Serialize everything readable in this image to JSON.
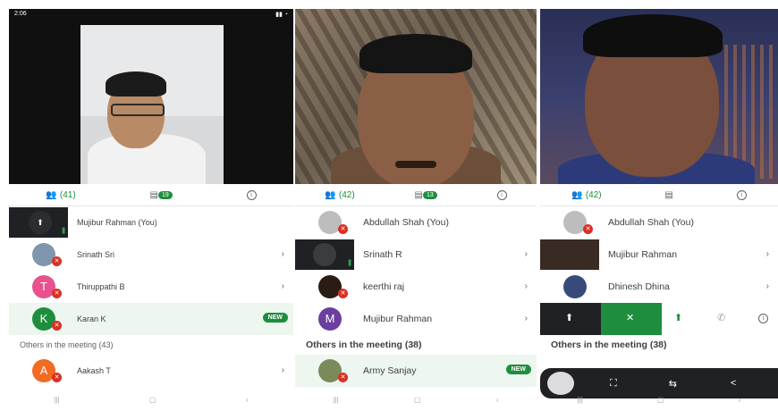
{
  "panel1": {
    "status_time": "2:06",
    "tabs": {
      "people_count": "(41)",
      "chat_count": "19"
    },
    "participants": [
      {
        "name": "Mujibur Rahman (You)",
        "type": "tile"
      },
      {
        "name": "Srinath Sri",
        "type": "photo",
        "color": "#8a9bb0"
      },
      {
        "name": "Thiruppathi B",
        "type": "letter",
        "letter": "T",
        "color": "#e8508e"
      },
      {
        "name": "Karan K",
        "type": "letter",
        "letter": "K",
        "color": "#1e8e3e",
        "badge": "NEW"
      }
    ],
    "section": "Others in the meeting (43)",
    "others": [
      {
        "name": "Aakash T",
        "letter": "A",
        "color": "#f26b21"
      }
    ]
  },
  "panel2": {
    "tabs": {
      "people_count": "(42)",
      "chat_count": "13"
    },
    "participants": [
      {
        "name": "Abdullah Shah (You)",
        "type": "grey"
      },
      {
        "name": "Srinath R",
        "type": "tile"
      },
      {
        "name": "keerthi raj",
        "type": "photo",
        "color": "#3a2a20"
      },
      {
        "name": "Mujibur Rahman",
        "type": "letter",
        "letter": "M",
        "color": "#6b3fa0"
      }
    ],
    "section": "Others in the meeting (38)",
    "others": [
      {
        "name": "Army Sanjay",
        "badge": "NEW"
      }
    ]
  },
  "panel3": {
    "tabs": {
      "people_count": "(42)"
    },
    "participants": [
      {
        "name": "Abdullah Shah (You)",
        "type": "grey"
      },
      {
        "name": "Mujibur Rahman",
        "type": "photo"
      },
      {
        "name": "Dhinesh Dhina",
        "type": "photo"
      }
    ],
    "section": "Others in the meeting (38)"
  },
  "colors": {
    "accent": "#1e8e3e",
    "mute": "#d93025"
  },
  "icons": [
    "people-icon",
    "chat-icon",
    "info-icon",
    "mic-off-icon",
    "chevron-right-icon",
    "pin-icon",
    "back-icon",
    "home-icon",
    "recents-icon"
  ]
}
